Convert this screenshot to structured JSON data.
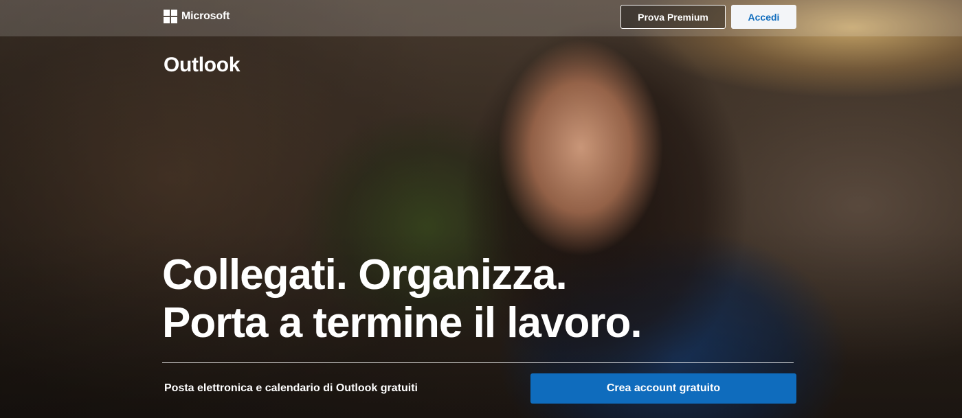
{
  "header": {
    "brand": "Microsoft",
    "premium_button": "Prova Premium",
    "signin_button": "Accedi"
  },
  "hero": {
    "product_title": "Outlook",
    "headline_line1": "Collegati. Organizza.",
    "headline_line2": "Porta a termine il lavoro.",
    "subtext": "Posta elettronica e calendario di Outlook gratuiti",
    "cta_button": "Crea account gratuito"
  },
  "colors": {
    "accent_blue": "#0f6cbd",
    "signin_bg": "#f3f5f8",
    "text": "#ffffff"
  },
  "icons": {
    "brand_logo": "microsoft-logo-icon"
  }
}
